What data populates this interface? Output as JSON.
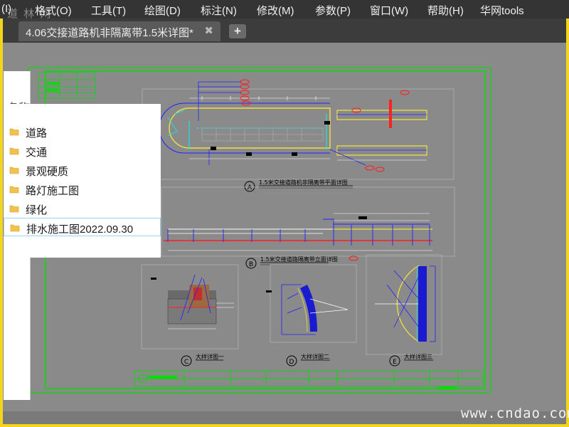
{
  "menubar": {
    "items": [
      "(I)",
      "格式(O)",
      "工具(T)",
      "绘图(D)",
      "标注(N)",
      "修改(M)",
      "参数(P)",
      "窗口(W)",
      "帮助(H)",
      "华网tools"
    ]
  },
  "tabs": {
    "active_title": "4.06交接道路机非隔离带1.5米详图*",
    "close_symbol": "✖",
    "new_symbol": "+"
  },
  "file_panel": {
    "header": "名称",
    "folders": [
      "道路",
      "交通",
      "景观硬质",
      "路灯施工图",
      "绿化",
      "排水施工图2022.09.30"
    ],
    "selected": "排水施工图2022.09.30"
  },
  "drawing": {
    "section_a": "1.5米交接道路机非隔离带平面详图",
    "section_b": "1.5米交接道路隔离带立面详图",
    "detail_c": "大样详图一",
    "detail_d": "大样详图二",
    "detail_e": "大样详图三",
    "label_a": "A",
    "label_b": "B",
    "label_c": "C",
    "label_d": "D",
    "label_e": "E"
  },
  "colors": {
    "menubar_bg": "#343434",
    "canvas_bg": "#8a8a8a",
    "frame_border": "#f2d51c",
    "cad_green": "#00e000",
    "cad_yellow": "#f0e040",
    "cad_blue": "#2020ff",
    "cad_red": "#ff2020",
    "cad_cyan": "#20e0e0"
  },
  "watermark": "www.cndao.com",
  "icons": [
    "folder-icon",
    "close-icon",
    "plus-icon"
  ]
}
